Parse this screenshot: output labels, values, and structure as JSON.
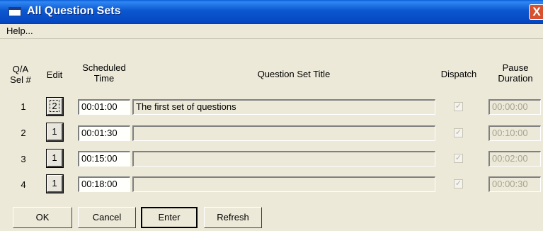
{
  "window": {
    "title": "All Question Sets",
    "close_label": "X"
  },
  "menu": {
    "help": "Help..."
  },
  "headers": {
    "qa_line1": "Q/A",
    "qa_line2": "Sel #",
    "edit": "Edit",
    "sched_line1": "Scheduled",
    "sched_line2": "Time",
    "title": "Question Set Title",
    "dispatch": "Dispatch",
    "pause_line1": "Pause",
    "pause_line2": "Duration"
  },
  "rows": [
    {
      "num": "1",
      "edit": "2",
      "time": "00:01:00",
      "title": "The first set of questions",
      "dispatch_checked": true,
      "pause": "00:00:00"
    },
    {
      "num": "2",
      "edit": "1",
      "time": "00:01:30",
      "title": "",
      "dispatch_checked": true,
      "pause": "00:10:00"
    },
    {
      "num": "3",
      "edit": "1",
      "time": "00:15:00",
      "title": "",
      "dispatch_checked": true,
      "pause": "00:02:00"
    },
    {
      "num": "4",
      "edit": "1",
      "time": "00:18:00",
      "title": "",
      "dispatch_checked": true,
      "pause": "00:00:30"
    }
  ],
  "buttons": {
    "ok": "OK",
    "cancel": "Cancel",
    "enter": "Enter",
    "refresh": "Refresh"
  },
  "colors": {
    "titlebar": "#0b58d0",
    "close": "#d8512f",
    "face": "#ece9d8"
  },
  "icons": {
    "window": "window-icon",
    "close": "close-icon",
    "check": "checkmark-icon"
  }
}
